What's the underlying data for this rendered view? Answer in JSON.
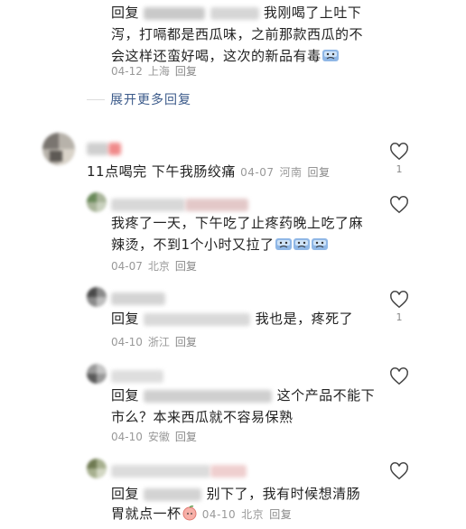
{
  "comments": [
    {
      "reply_word": "回复",
      "text_line1": "我刚喝了上吐下",
      "text_line2": "泻，打嗝都是西瓜味，之前那款西瓜的不",
      "text_line3": "会这样还蛮好喝，这次的新品有毒",
      "date": "04-12",
      "location": "上海",
      "reply_label": "回复"
    },
    {
      "text": "11点喝完 下午我肠绞痛",
      "date": "04-07",
      "location": "河南",
      "reply_label": "回复",
      "like_count": "1"
    },
    {
      "text_line1": "我疼了一天，下午吃了止疼药晚上吃了麻",
      "text_line2": "辣烫，不到1个小时又拉了",
      "date": "04-07",
      "location": "北京",
      "reply_label": "回复"
    },
    {
      "reply_word": "回复",
      "text": "我也是，疼死了",
      "date": "04-10",
      "location": "浙江",
      "reply_label": "回复",
      "like_count": "1"
    },
    {
      "reply_word": "回复",
      "text_line1": "这个产品不能下",
      "text_line2": "市么？本来西瓜就不容易保熟",
      "date": "04-10",
      "location": "安徽",
      "reply_label": "回复"
    },
    {
      "reply_word": "回复",
      "text_line1": "别下了，我有时候想清肠",
      "text_line2": "胃就点一杯",
      "date": "04-10",
      "location": "北京",
      "reply_label": "回复"
    }
  ],
  "expand_more": "展开更多回复",
  "icons": {
    "like": "heart-outline-icon",
    "sick_emoji": "sick-face-emoji-icon",
    "peach_emoji": "peach-emoji-icon"
  },
  "colors": {
    "link": "#3b5a8a",
    "meta": "#999999",
    "text": "#222222"
  }
}
